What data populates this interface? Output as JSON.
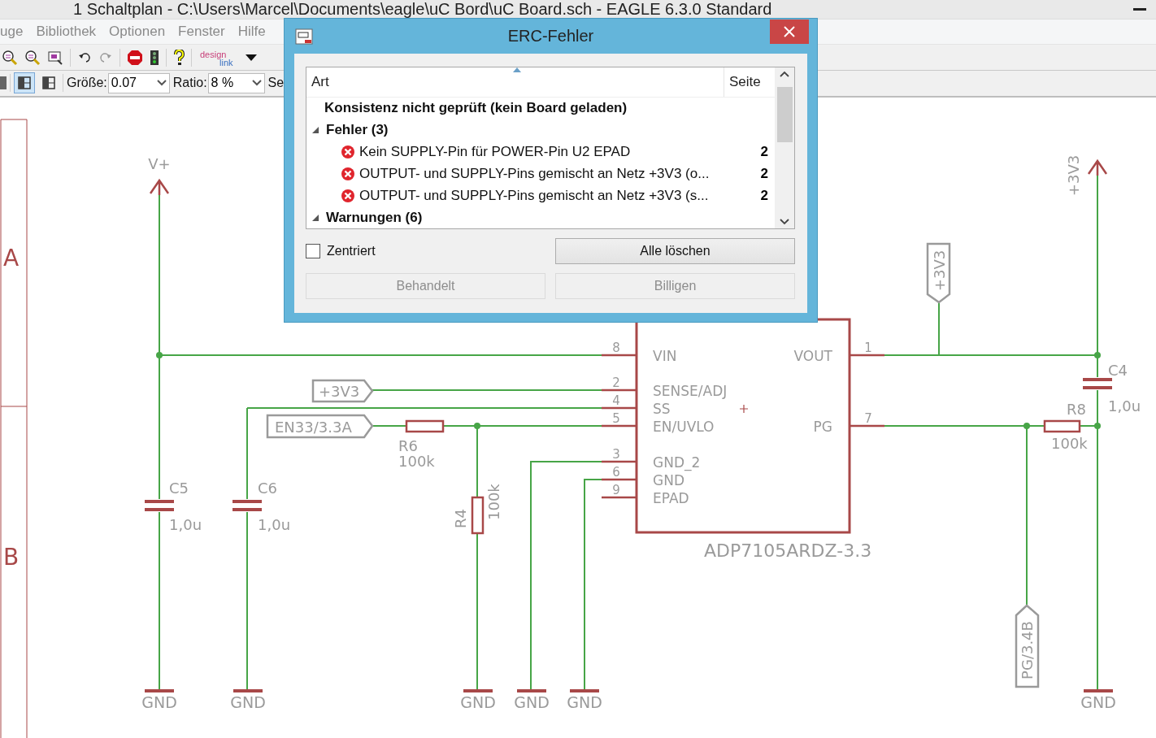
{
  "window": {
    "title": "1 Schaltplan - C:\\Users\\Marcel\\Documents\\eagle\\uC Bord\\uC Board.sch - EAGLE 6.3.0 Standard"
  },
  "menu": [
    "uge",
    "Bibliothek",
    "Optionen",
    "Fenster",
    "Hilfe"
  ],
  "toolbar": {
    "logo": [
      "design",
      "link"
    ]
  },
  "param_bar": {
    "layout_buttons": [
      {
        "selected": true
      },
      {
        "selected": false
      }
    ],
    "fields": [
      {
        "label": "Größe:",
        "value": "0.07"
      },
      {
        "label": "Ratio:",
        "value": "8 %"
      }
    ],
    "cut_label": "Se"
  },
  "schematic": {
    "frame_rows": [
      "A",
      "B"
    ],
    "supplies": [
      {
        "label": "V+"
      },
      {
        "label": "+3V3"
      }
    ],
    "grounds": [
      "GND",
      "GND",
      "GND",
      "GND",
      "GND",
      "GND"
    ],
    "net_labels": [
      "+3V3",
      "EN33/3.3A",
      "+3V3",
      "PG/3.4B"
    ],
    "chip": {
      "name": "ADP7105ARDZ-3.3",
      "pins_left": [
        {
          "number": "8",
          "name": "VIN"
        },
        {
          "number": "2",
          "name": "SENSE/ADJ"
        },
        {
          "number": "4",
          "name": "SS"
        },
        {
          "number": "5",
          "name": "EN/UVLO"
        },
        {
          "number": "3",
          "name": "GND_2"
        },
        {
          "number": "6",
          "name": "GND"
        },
        {
          "number": "9",
          "name": "EPAD"
        }
      ],
      "pins_right": [
        {
          "number": "1",
          "name": "VOUT"
        },
        {
          "number": "7",
          "name": "PG"
        }
      ]
    },
    "parts": [
      {
        "name": "C5",
        "value": "1,0u"
      },
      {
        "name": "C6",
        "value": "1,0u"
      },
      {
        "name": "R6",
        "value": "100k"
      },
      {
        "name": "R4",
        "value": "100k"
      },
      {
        "name": "R8",
        "value": "100k"
      },
      {
        "name": "C4",
        "value": "1,0u"
      }
    ]
  },
  "dialog": {
    "title": "ERC-Fehler",
    "columns": [
      "Art",
      "Seite"
    ],
    "rows": [
      {
        "kind": "info",
        "text": "Konsistenz nicht geprüft (kein Board geladen)"
      },
      {
        "kind": "group",
        "text": "Fehler (3)",
        "expanded": true,
        "children": [
          {
            "kind": "error",
            "text": "Kein SUPPLY-Pin für POWER-Pin U2 EPAD",
            "page": "2"
          },
          {
            "kind": "error",
            "text": "OUTPUT- und SUPPLY-Pins gemischt an Netz +3V3 (o...",
            "page": "2"
          },
          {
            "kind": "error",
            "text": "OUTPUT- und SUPPLY-Pins gemischt an Netz +3V3 (s...",
            "page": "2"
          }
        ]
      },
      {
        "kind": "group",
        "text": "Warnungen (6)",
        "expanded": true
      }
    ],
    "checkbox": {
      "label": "Zentriert",
      "checked": false
    },
    "buttons": [
      {
        "label": "Alle löschen",
        "disabled": false
      },
      {
        "label": "Behandelt",
        "disabled": true
      },
      {
        "label": "Billigen",
        "disabled": true
      }
    ]
  }
}
